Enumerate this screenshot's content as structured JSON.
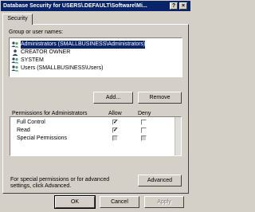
{
  "window": {
    "title": "Database Security for USERS\\.DEFAULT\\Software\\Mi...",
    "help_label": "?",
    "close_label": "×"
  },
  "tabs": [
    {
      "label": "Security"
    }
  ],
  "group_label": "Group or user names:",
  "users": [
    {
      "name": "Administrators (SMALLBUSINESS\\Administrators)",
      "icon": "users-icon",
      "selected": true
    },
    {
      "name": "CREATOR OWNER",
      "icon": "user-icon",
      "selected": false
    },
    {
      "name": "SYSTEM",
      "icon": "users-icon",
      "selected": false
    },
    {
      "name": "Users (SMALLBUSINESS\\Users)",
      "icon": "users-icon",
      "selected": false
    }
  ],
  "buttons": {
    "add": "Add...",
    "remove": "Remove",
    "advanced": "Advanced",
    "ok": "OK",
    "cancel": "Cancel",
    "apply": "Apply"
  },
  "permissions": {
    "header": "Permissions for Administrators",
    "allow": "Allow",
    "deny": "Deny",
    "rows": [
      {
        "label": "Full Control",
        "allow": true,
        "deny": false
      },
      {
        "label": "Read",
        "allow": true,
        "deny": false
      },
      {
        "label": "Special Permissions",
        "allow": false,
        "deny": false,
        "disabled": true
      }
    ]
  },
  "advanced_note": "For special permissions or for advanced settings, click Advanced."
}
